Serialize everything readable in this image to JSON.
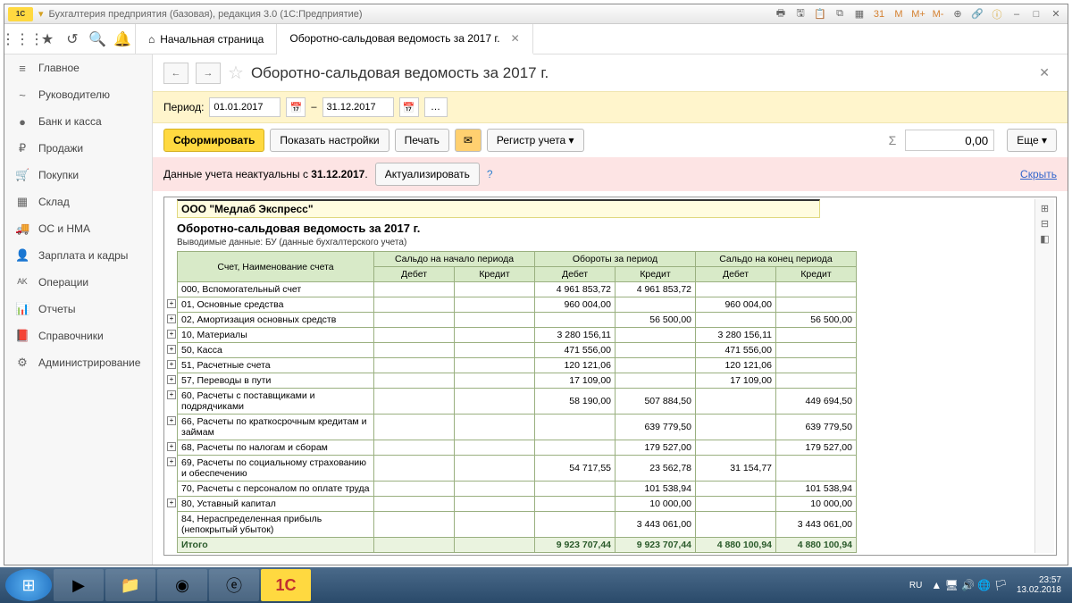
{
  "window": {
    "title": "Бухгалтерия предприятия (базовая), редакция 3.0  (1С:Предприятие)",
    "logo": "1С"
  },
  "tabs": {
    "home": "Начальная страница",
    "active": "Оборотно-сальдовая ведомость за 2017 г."
  },
  "sidebar": {
    "items": [
      {
        "icon": "≡",
        "label": "Главное"
      },
      {
        "icon": "~",
        "label": "Руководителю"
      },
      {
        "icon": "●",
        "label": "Банк и касса"
      },
      {
        "icon": "₽",
        "label": "Продажи"
      },
      {
        "icon": "🛒",
        "label": "Покупки"
      },
      {
        "icon": "▦",
        "label": "Склад"
      },
      {
        "icon": "🚚",
        "label": "ОС и НМА"
      },
      {
        "icon": "👤",
        "label": "Зарплата и кадры"
      },
      {
        "icon": "ᴬᴷ",
        "label": "Операции"
      },
      {
        "icon": "📊",
        "label": "Отчеты"
      },
      {
        "icon": "📕",
        "label": "Справочники"
      },
      {
        "icon": "⚙",
        "label": "Администрирование"
      }
    ]
  },
  "page": {
    "title": "Оборотно-сальдовая ведомость за 2017 г."
  },
  "period": {
    "label": "Период:",
    "from": "01.01.2017",
    "to": "31.12.2017",
    "dash": "–"
  },
  "actions": {
    "form": "Сформировать",
    "settings": "Показать настройки",
    "print": "Печать",
    "register": "Регистр учета",
    "more": "Еще",
    "sum_value": "0,00"
  },
  "alert": {
    "text_prefix": "Данные учета неактуальны с ",
    "date": "31.12.2017",
    "text_suffix": ".",
    "refresh": "Актуализировать",
    "hide": "Скрыть"
  },
  "report": {
    "org": "ООО \"Медлаб Экспресс\"",
    "title": "Оборотно-сальдовая ведомость за 2017 г.",
    "subtitle": "Выводимые данные:  БУ (данные бухгалтерского учета)",
    "headers": {
      "account": "Счет, Наименование счета",
      "start": "Сальдо на начало периода",
      "turn": "Обороты за период",
      "end": "Сальдо на конец периода",
      "debit": "Дебет",
      "credit": "Кредит"
    },
    "rows": [
      {
        "exp": false,
        "name": "000, Вспомогательный счет",
        "sd": "",
        "sc": "",
        "td": "4 961 853,72",
        "tc": "4 961 853,72",
        "ed": "",
        "ec": ""
      },
      {
        "exp": true,
        "name": "01, Основные средства",
        "sd": "",
        "sc": "",
        "td": "960 004,00",
        "tc": "",
        "ed": "960 004,00",
        "ec": ""
      },
      {
        "exp": true,
        "name": "02, Амортизация основных средств",
        "sd": "",
        "sc": "",
        "td": "",
        "tc": "56 500,00",
        "ed": "",
        "ec": "56 500,00"
      },
      {
        "exp": true,
        "name": "10, Материалы",
        "sd": "",
        "sc": "",
        "td": "3 280 156,11",
        "tc": "",
        "ed": "3 280 156,11",
        "ec": ""
      },
      {
        "exp": true,
        "name": "50, Касса",
        "sd": "",
        "sc": "",
        "td": "471 556,00",
        "tc": "",
        "ed": "471 556,00",
        "ec": ""
      },
      {
        "exp": true,
        "name": "51, Расчетные счета",
        "sd": "",
        "sc": "",
        "td": "120 121,06",
        "tc": "",
        "ed": "120 121,06",
        "ec": ""
      },
      {
        "exp": true,
        "name": "57, Переводы в пути",
        "sd": "",
        "sc": "",
        "td": "17 109,00",
        "tc": "",
        "ed": "17 109,00",
        "ec": ""
      },
      {
        "exp": true,
        "name": "60, Расчеты с поставщиками и подрядчиками",
        "sd": "",
        "sc": "",
        "td": "58 190,00",
        "tc": "507 884,50",
        "ed": "",
        "ec": "449 694,50"
      },
      {
        "exp": true,
        "name": "66, Расчеты по краткосрочным кредитам и займам",
        "sd": "",
        "sc": "",
        "td": "",
        "tc": "639 779,50",
        "ed": "",
        "ec": "639 779,50"
      },
      {
        "exp": true,
        "name": "68, Расчеты по налогам и сборам",
        "sd": "",
        "sc": "",
        "td": "",
        "tc": "179 527,00",
        "ed": "",
        "ec": "179 527,00"
      },
      {
        "exp": true,
        "name": "69, Расчеты по социальному страхованию и обеспечению",
        "sd": "",
        "sc": "",
        "td": "54 717,55",
        "tc": "23 562,78",
        "ed": "31 154,77",
        "ec": ""
      },
      {
        "exp": false,
        "name": "70, Расчеты с персоналом по оплате труда",
        "sd": "",
        "sc": "",
        "td": "",
        "tc": "101 538,94",
        "ed": "",
        "ec": "101 538,94"
      },
      {
        "exp": true,
        "name": "80, Уставный капитал",
        "sd": "",
        "sc": "",
        "td": "",
        "tc": "10 000,00",
        "ed": "",
        "ec": "10 000,00"
      },
      {
        "exp": false,
        "name": "84, Нераспределенная прибыль (непокрытый убыток)",
        "sd": "",
        "sc": "",
        "td": "",
        "tc": "3 443 061,00",
        "ed": "",
        "ec": "3 443 061,00"
      }
    ],
    "total": {
      "label": "Итого",
      "sd": "",
      "sc": "",
      "td": "9 923 707,44",
      "tc": "9 923 707,44",
      "ed": "4 880 100,94",
      "ec": "4 880 100,94"
    }
  },
  "taskbar": {
    "lang": "RU",
    "time": "23:57",
    "date": "13.02.2018"
  }
}
